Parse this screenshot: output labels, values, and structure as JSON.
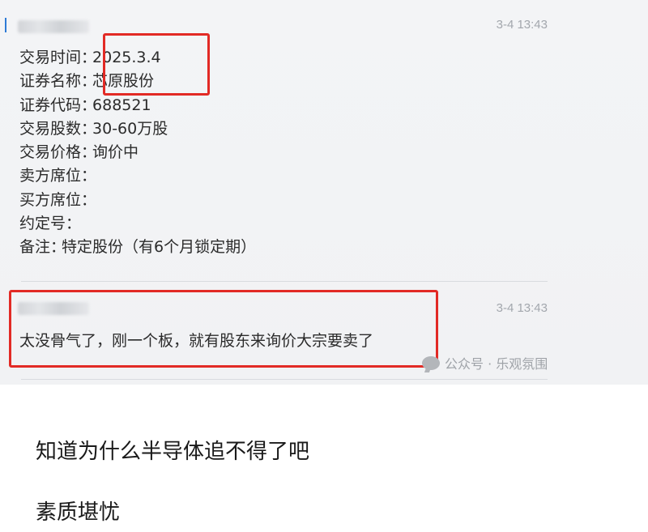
{
  "message1": {
    "timestamp": "3-4 13:43",
    "fields": [
      {
        "label": "交易时间",
        "value": "2025.3.4"
      },
      {
        "label": "证券名称",
        "value": "芯原股份"
      },
      {
        "label": "证券代码",
        "value": "688521"
      },
      {
        "label": "交易股数",
        "value": "30-60万股"
      },
      {
        "label": "交易价格",
        "value": "询价中"
      },
      {
        "label": "卖方席位",
        "value": ""
      },
      {
        "label": "买方席位",
        "value": ""
      },
      {
        "label": "约定号",
        "value": ""
      },
      {
        "label": "备注",
        "value": "特定股份（有6个月锁定期）"
      }
    ],
    "separator": "："
  },
  "message2": {
    "timestamp": "3-4 13:43",
    "text": "太没骨气了，刚一个板，就有股东来询价大宗要卖了"
  },
  "watermark": {
    "icon": "wechat-icon",
    "text": "公众号 · 乐观氛围"
  },
  "captions": [
    "知道为什么半导体追不得了吧",
    "素质堪忧"
  ],
  "colors": {
    "highlight_box": "#e22a25",
    "chat_background": "#f2f3f5",
    "timestamp": "#a3a7ad"
  }
}
